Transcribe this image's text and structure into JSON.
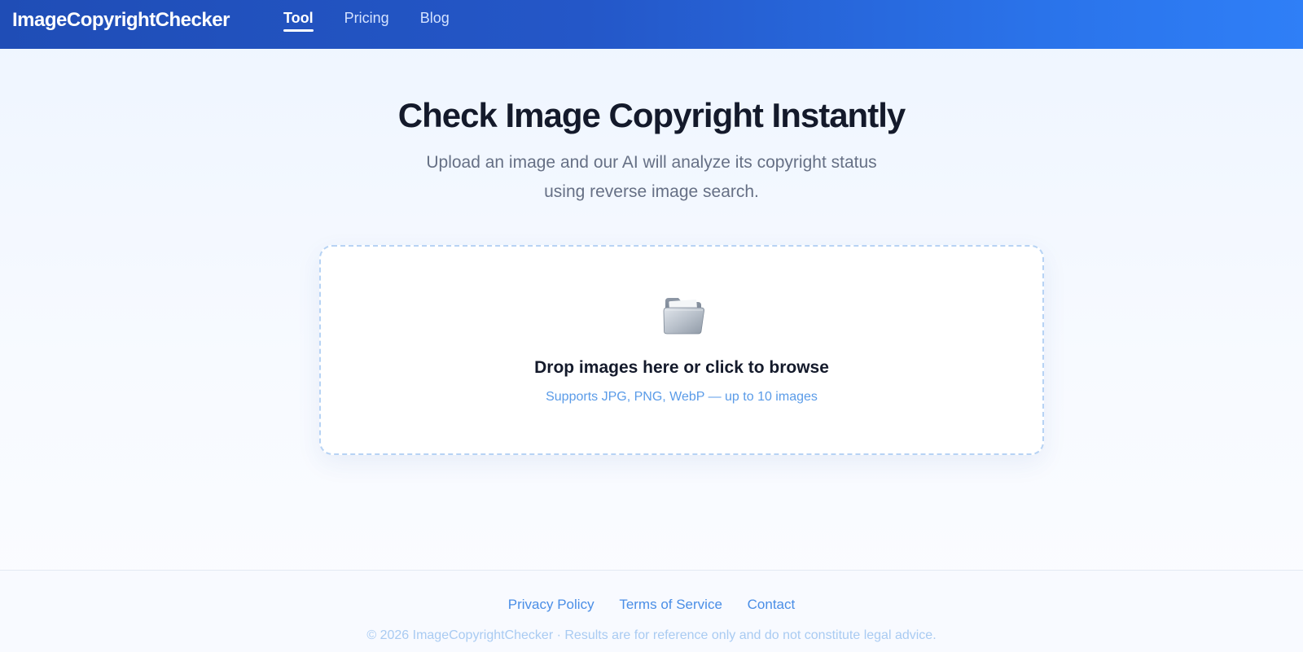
{
  "header": {
    "brand": "ImageCopyrightChecker",
    "nav": [
      {
        "label": "Tool",
        "active": true
      },
      {
        "label": "Pricing",
        "active": false
      },
      {
        "label": "Blog",
        "active": false
      }
    ]
  },
  "hero": {
    "title": "Check Image Copyright Instantly",
    "subtitle": "Upload an image and our AI will analyze its copyright status using reverse image search."
  },
  "upload": {
    "icon": "folder-icon",
    "title": "Drop images here or click to browse",
    "hint": "Supports JPG, PNG, WebP — up to 10 images"
  },
  "footer": {
    "links": [
      "Privacy Policy",
      "Terms of Service",
      "Contact"
    ],
    "copyright": "© 2026 ImageCopyrightChecker · Results are for reference only and do not constitute legal advice."
  },
  "colors": {
    "header_start": "#1f4db6",
    "header_end": "#2f7ff7",
    "accent": "#4a8ee6",
    "heading": "#141a2b"
  }
}
